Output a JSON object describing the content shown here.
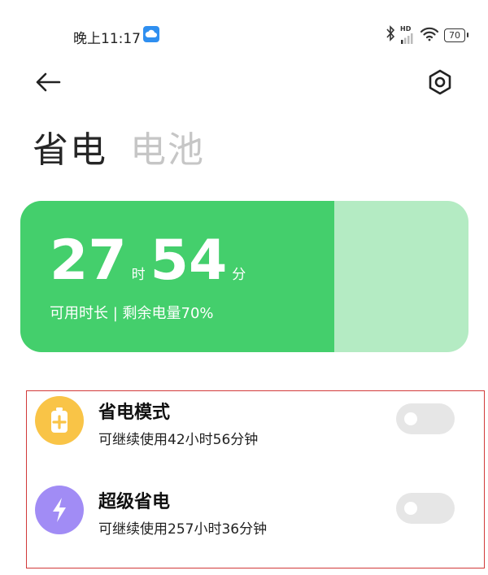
{
  "status_bar": {
    "time": "晚上11:17",
    "network": "HD",
    "battery_level": "70"
  },
  "tabs": [
    {
      "label": "省电",
      "active": true
    },
    {
      "label": "电池",
      "active": false
    }
  ],
  "battery_card": {
    "hours": "27",
    "hours_unit": "时",
    "minutes": "54",
    "minutes_unit": "分",
    "subtitle": "可用时长 | 剩余电量70%",
    "charge_fraction": 0.7,
    "fill_color": "#44cf6c",
    "track_color": "#b4ebc3"
  },
  "modes": [
    {
      "title": "省电模式",
      "subtitle": "可继续使用42小时56分钟",
      "icon": "battery-plus-icon",
      "icon_color": "#f9c447",
      "enabled": false
    },
    {
      "title": "超级省电",
      "subtitle": "可继续使用257小时36分钟",
      "icon": "lightning-icon",
      "icon_color": "#a18cf5",
      "enabled": false
    }
  ]
}
